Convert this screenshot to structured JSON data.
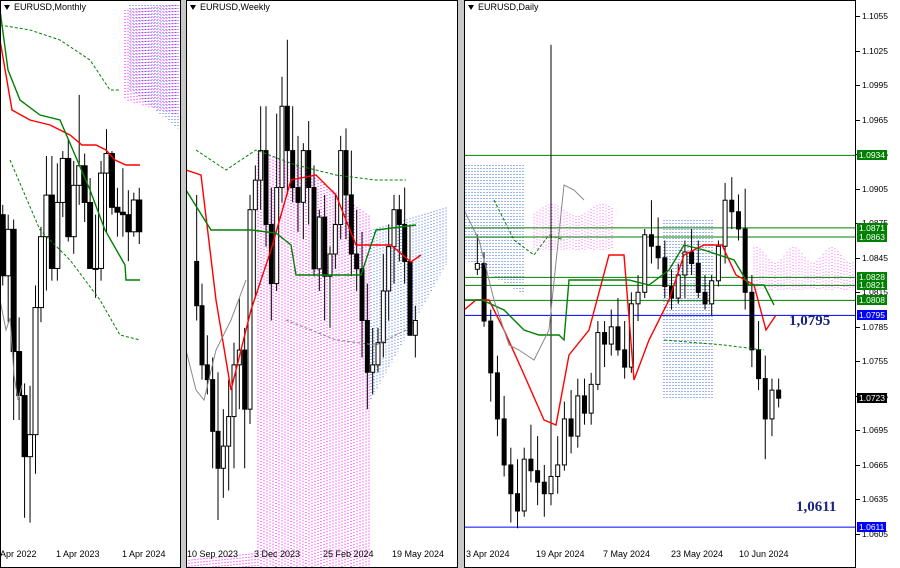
{
  "panels": [
    {
      "id": "monthly",
      "title": "EURUSD,Monthly",
      "x_labels": [
        "Apr 2022",
        "1 Apr 2023",
        "1 Apr 2024"
      ]
    },
    {
      "id": "weekly",
      "title": "EURUSD,Weekly",
      "x_labels": [
        "10 Sep 2023",
        "3 Dec 2023",
        "25 Feb 2024",
        "19 May 2024"
      ]
    },
    {
      "id": "daily",
      "title": "EURUSD,Daily",
      "x_labels": [
        "3 Apr 2024",
        "19 Apr 2024",
        "7 May 2024",
        "23 May 2024",
        "10 Jun 2024"
      ]
    }
  ],
  "price_scale": {
    "ticks": [
      "1.1055",
      "1.1025",
      "1.0995",
      "1.0965",
      "1.0935",
      "1.0905",
      "1.0875",
      "1.0845",
      "1.0815",
      "1.0785",
      "1.0755",
      "1.0725",
      "1.0695",
      "1.0665",
      "1.0635",
      "1.0605"
    ],
    "level_tags": [
      {
        "label": "1.0934",
        "color": "#008000"
      },
      {
        "label": "1.0871",
        "color": "#008000"
      },
      {
        "label": "1.0863",
        "color": "#008000"
      },
      {
        "label": "1.0828",
        "color": "#008000"
      },
      {
        "label": "1.0821",
        "color": "#008000"
      },
      {
        "label": "1.0808",
        "color": "#008000"
      },
      {
        "label": "1.0795",
        "color": "#0000ff"
      },
      {
        "label": "1.0723",
        "color": "#000000"
      },
      {
        "label": "1.0611",
        "color": "#0000ff"
      }
    ]
  },
  "annotations": {
    "upper_level": "1,0795",
    "lower_level": "1,0611"
  },
  "chart_data": [
    {
      "type": "candlestick",
      "timeframe": "Monthly",
      "symbol": "EURUSD",
      "xlabels": [
        "Apr 2022",
        "1 Apr 2023",
        "1 Apr 2024"
      ],
      "note": "Monthly candles with Ichimoku lines; daily-axis price scale not shown for this panel",
      "candles_ohlc": [
        [
          1.079,
          1.083,
          1.05,
          1.054
        ],
        [
          1.054,
          1.079,
          1.035,
          1.073
        ],
        [
          1.073,
          1.077,
          0.995,
          1.023
        ],
        [
          1.023,
          1.037,
          0.995,
          1.005
        ],
        [
          1.005,
          1.01,
          0.955,
          0.98
        ],
        [
          0.98,
          1.009,
          0.953,
          0.989
        ],
        [
          0.989,
          1.05,
          0.973,
          1.041
        ],
        [
          1.041,
          1.074,
          1.035,
          1.07
        ],
        [
          1.07,
          1.103,
          1.048,
          1.087
        ],
        [
          1.087,
          1.103,
          1.052,
          1.057
        ],
        [
          1.057,
          1.1,
          1.052,
          1.084
        ],
        [
          1.084,
          1.105,
          1.078,
          1.102
        ],
        [
          1.102,
          1.11,
          1.068,
          1.07
        ],
        [
          1.07,
          1.101,
          1.063,
          1.091
        ],
        [
          1.091,
          1.128,
          1.083,
          1.099
        ],
        [
          1.099,
          1.104,
          1.076,
          1.084
        ],
        [
          1.084,
          1.094,
          1.06,
          1.057
        ],
        [
          1.057,
          1.079,
          1.045,
          1.057
        ],
        [
          1.057,
          1.101,
          1.052,
          1.096
        ],
        [
          1.096,
          1.114,
          1.072,
          1.104
        ],
        [
          1.104,
          1.105,
          1.079,
          1.082
        ],
        [
          1.082,
          1.09,
          1.07,
          1.08
        ],
        [
          1.08,
          1.098,
          1.07,
          1.079
        ],
        [
          1.079,
          1.089,
          1.06,
          1.072
        ],
        [
          1.072,
          1.088,
          1.07,
          1.085
        ],
        [
          1.085,
          1.09,
          1.067,
          1.072
        ]
      ]
    },
    {
      "type": "candlestick",
      "timeframe": "Weekly",
      "symbol": "EURUSD",
      "xlabels": [
        "10 Sep 2023",
        "3 Dec 2023",
        "25 Feb 2024",
        "19 May 2024"
      ],
      "candles_ohlc": [
        [
          1.08,
          1.089,
          1.072,
          1.074
        ],
        [
          1.074,
          1.077,
          1.064,
          1.066
        ],
        [
          1.066,
          1.07,
          1.062,
          1.064
        ],
        [
          1.064,
          1.067,
          1.052,
          1.057
        ],
        [
          1.057,
          1.065,
          1.045,
          1.052
        ],
        [
          1.052,
          1.06,
          1.048,
          1.055
        ],
        [
          1.055,
          1.064,
          1.049,
          1.059
        ],
        [
          1.059,
          1.069,
          1.052,
          1.066
        ],
        [
          1.066,
          1.075,
          1.06,
          1.068
        ],
        [
          1.068,
          1.071,
          1.052,
          1.06
        ],
        [
          1.06,
          1.089,
          1.058,
          1.087
        ],
        [
          1.087,
          1.093,
          1.075,
          1.091
        ],
        [
          1.091,
          1.101,
          1.087,
          1.095
        ],
        [
          1.095,
          1.101,
          1.082,
          1.085
        ],
        [
          1.085,
          1.09,
          1.072,
          1.077
        ],
        [
          1.077,
          1.1,
          1.076,
          1.09
        ],
        [
          1.09,
          1.105,
          1.088,
          1.101
        ],
        [
          1.101,
          1.11,
          1.089,
          1.095
        ],
        [
          1.095,
          1.101,
          1.088,
          1.09
        ],
        [
          1.09,
          1.097,
          1.084,
          1.088
        ],
        [
          1.088,
          1.096,
          1.083,
          1.095
        ],
        [
          1.095,
          1.099,
          1.085,
          1.09
        ],
        [
          1.09,
          1.093,
          1.078,
          1.079
        ],
        [
          1.079,
          1.087,
          1.076,
          1.086
        ],
        [
          1.086,
          1.089,
          1.072,
          1.078
        ],
        [
          1.078,
          1.082,
          1.071,
          1.081
        ],
        [
          1.081,
          1.089,
          1.079,
          1.085
        ],
        [
          1.085,
          1.097,
          1.083,
          1.095
        ],
        [
          1.095,
          1.098,
          1.083,
          1.089
        ],
        [
          1.089,
          1.095,
          1.078,
          1.081
        ],
        [
          1.081,
          1.087,
          1.076,
          1.079
        ],
        [
          1.079,
          1.084,
          1.067,
          1.072
        ],
        [
          1.072,
          1.077,
          1.06,
          1.065
        ],
        [
          1.065,
          1.071,
          1.062,
          1.066
        ],
        [
          1.066,
          1.071,
          1.065,
          1.069
        ],
        [
          1.069,
          1.081,
          1.067,
          1.076
        ],
        [
          1.076,
          1.085,
          1.072,
          1.082
        ],
        [
          1.082,
          1.089,
          1.077,
          1.087
        ],
        [
          1.087,
          1.089,
          1.08,
          1.085
        ],
        [
          1.085,
          1.09,
          1.077,
          1.08
        ],
        [
          1.08,
          1.085,
          1.071,
          1.07
        ],
        [
          1.07,
          1.074,
          1.067,
          1.072
        ]
      ]
    },
    {
      "type": "candlestick",
      "timeframe": "Daily",
      "symbol": "EURUSD",
      "xlabels": [
        "3 Apr 2024",
        "19 Apr 2024",
        "7 May 2024",
        "23 May 2024",
        "10 Jun 2024"
      ],
      "ylim": [
        1.0605,
        1.1062
      ],
      "y_ticks": [
        1.1055,
        1.1025,
        1.0995,
        1.0965,
        1.0935,
        1.0905,
        1.0875,
        1.0845,
        1.0815,
        1.0785,
        1.0755,
        1.0725,
        1.0695,
        1.0665,
        1.0635,
        1.0605
      ],
      "horizontal_levels": [
        {
          "value": 1.0934,
          "color": "#008000"
        },
        {
          "value": 1.0871,
          "color": "#008000"
        },
        {
          "value": 1.0863,
          "color": "#008000"
        },
        {
          "value": 1.0828,
          "color": "#008000"
        },
        {
          "value": 1.0821,
          "color": "#008000"
        },
        {
          "value": 1.0808,
          "color": "#008000"
        },
        {
          "value": 1.0795,
          "color": "#0000ff"
        },
        {
          "value": 1.0611,
          "color": "#0000ff"
        }
      ],
      "last_price": 1.0723,
      "candles_ohlc": [
        [
          1.0835,
          1.0865,
          1.083,
          1.084
        ],
        [
          1.084,
          1.085,
          1.0785,
          1.079
        ],
        [
          1.079,
          1.08,
          1.072,
          1.0745
        ],
        [
          1.0745,
          1.076,
          1.069,
          1.0705
        ],
        [
          1.0705,
          1.0725,
          1.0655,
          1.0665
        ],
        [
          1.0665,
          1.068,
          1.0615,
          1.064
        ],
        [
          1.064,
          1.067,
          1.061,
          1.0625
        ],
        [
          1.0625,
          1.068,
          1.062,
          1.067
        ],
        [
          1.067,
          1.07,
          1.065,
          1.066
        ],
        [
          1.066,
          1.069,
          1.063,
          1.065
        ],
        [
          1.065,
          1.0665,
          1.062,
          1.064
        ],
        [
          1.064,
          1.103,
          1.063,
          1.0655
        ],
        [
          1.0655,
          1.069,
          1.064,
          1.0665
        ],
        [
          1.0665,
          1.072,
          1.066,
          1.0705
        ],
        [
          1.0705,
          1.073,
          1.0675,
          1.069
        ],
        [
          1.069,
          1.074,
          1.068,
          1.0725
        ],
        [
          1.0725,
          1.074,
          1.07,
          1.071
        ],
        [
          1.071,
          1.0745,
          1.07,
          1.0735
        ],
        [
          1.0735,
          1.079,
          1.073,
          1.078
        ],
        [
          1.078,
          1.079,
          1.075,
          1.077
        ],
        [
          1.077,
          1.08,
          1.076,
          1.0785
        ],
        [
          1.0785,
          1.081,
          1.076,
          1.0765
        ],
        [
          1.0765,
          1.079,
          1.074,
          1.075
        ],
        [
          1.075,
          1.0815,
          1.0745,
          1.0805
        ],
        [
          1.0805,
          1.083,
          1.079,
          1.0815
        ],
        [
          1.0815,
          1.087,
          1.081,
          1.0865
        ],
        [
          1.0865,
          1.0895,
          1.084,
          1.0855
        ],
        [
          1.0855,
          1.088,
          1.0835,
          1.0845
        ],
        [
          1.0845,
          1.086,
          1.081,
          1.082
        ],
        [
          1.082,
          1.0835,
          1.08,
          1.081
        ],
        [
          1.081,
          1.084,
          1.0805,
          1.083
        ],
        [
          1.083,
          1.086,
          1.081,
          1.085
        ],
        [
          1.085,
          1.087,
          1.083,
          1.084
        ],
        [
          1.084,
          1.086,
          1.081,
          1.0815
        ],
        [
          1.0815,
          1.083,
          1.08,
          1.0805
        ],
        [
          1.0805,
          1.083,
          1.0795,
          1.0825
        ],
        [
          1.0825,
          1.086,
          1.082,
          1.0855
        ],
        [
          1.0855,
          1.091,
          1.084,
          1.0895
        ],
        [
          1.0895,
          1.0915,
          1.087,
          1.0885
        ],
        [
          1.0885,
          1.09,
          1.086,
          1.087
        ],
        [
          1.087,
          1.0905,
          1.08,
          1.0815
        ],
        [
          1.0815,
          1.083,
          1.075,
          1.0765
        ],
        [
          1.0765,
          1.079,
          1.073,
          1.074
        ],
        [
          1.074,
          1.076,
          1.067,
          1.0705
        ],
        [
          1.0705,
          1.074,
          1.069,
          1.073
        ],
        [
          1.073,
          1.074,
          1.0715,
          1.0723
        ]
      ]
    }
  ]
}
